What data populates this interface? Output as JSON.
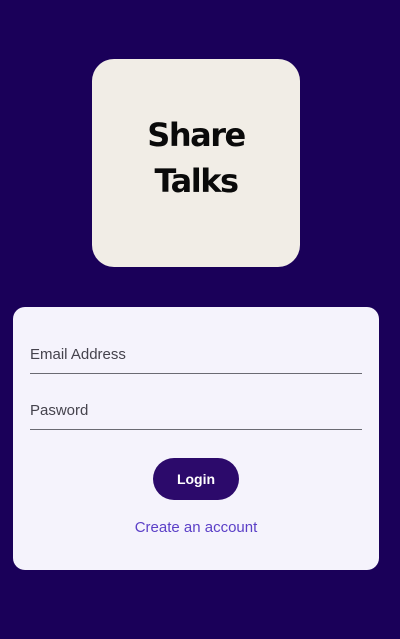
{
  "logo": {
    "line1": "Share",
    "line2": "Talks"
  },
  "login_form": {
    "email_placeholder": "Email Address",
    "password_placeholder": "Pasword",
    "login_button_label": "Login",
    "create_account_link": "Create an account"
  },
  "colors": {
    "background": "#1a0059",
    "logo_card": "#f1ede6",
    "form_card": "#f5f3fc",
    "button": "#2c0a6b",
    "link": "#5b3fc7"
  }
}
